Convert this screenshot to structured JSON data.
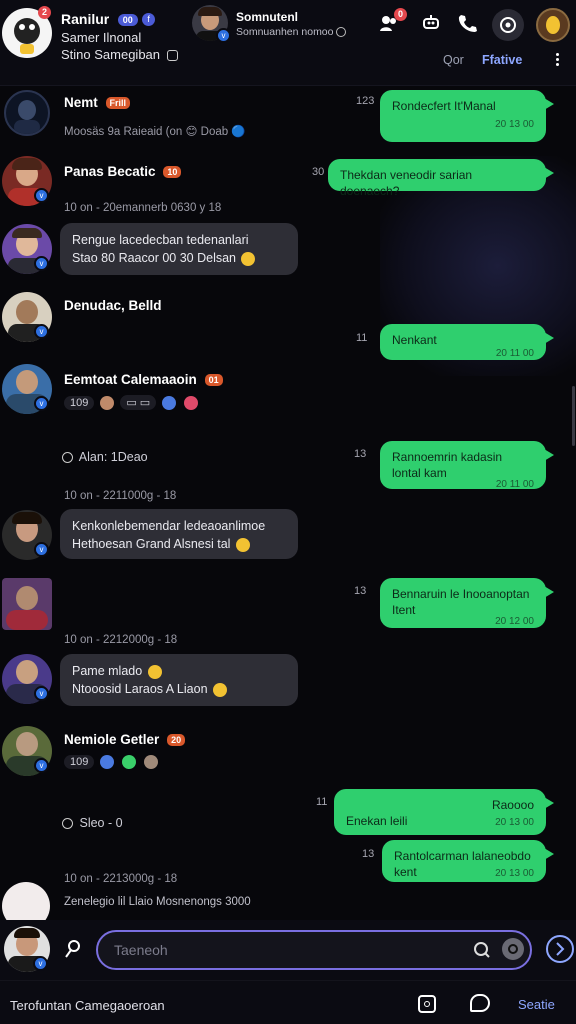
{
  "header": {
    "title": "Ranilur",
    "subtitle": "Samer Ilnonal",
    "status": "Stino Samegiban",
    "notif_badge": "2",
    "title_badge": "00",
    "contact_name": "Somnutenl",
    "contact_status": "Somnuanhen nomoo",
    "call_badge": "0",
    "tab_1": "Qor",
    "tab_2": "Ffative"
  },
  "messages": [
    {
      "user": "Nemt",
      "badge": "Frill",
      "meta": "Moosäs 9a Raieaid (on 😊 Doab 🔵",
      "out_text": "Rondecfert It'Manal",
      "out_time": "20 13 00",
      "side_time": "123"
    },
    {
      "user": "Panas Becatic",
      "badge": "10",
      "meta": "10 on - 20emannerb  0630 y 18",
      "out_text": "Thekdan veneodir sarian doenaech?",
      "side_time": "30"
    },
    {
      "user": "",
      "in_text_1": "Rengue lacedecban tedenanlari",
      "in_text_2": "Stao 80  Raacor 00  30  Delsan"
    },
    {
      "user": "Denudac, Belld",
      "out_text": "Nenkant",
      "out_time": "20 11 00",
      "side_time": "11"
    },
    {
      "user": "Eemtoat Calemaaoin",
      "badge": "01",
      "reacts": "109"
    },
    {
      "system": "Alan: 1Deao",
      "out_text": "Rannoemrin kadasin lontal kam",
      "out_time": "20 11 00",
      "side_time": "13"
    },
    {
      "meta": "10 on - 2211000g - 18",
      "in_text_1": "Kenkonlebemendar ledeaoanlimoe",
      "in_text_2": "Hethoesan  Grand  Alsnesi tal"
    },
    {
      "out_text": "Bennaruin le Inooanoptan Itent",
      "out_time": "20 12 00",
      "side_time": "13"
    },
    {
      "meta": "10 on - 2212000g - 18",
      "in_text_1": "Pame mlado",
      "in_text_2": "Ntooosid  Laraos  A  Liaon"
    },
    {
      "user": "Nemiole Getler",
      "badge": "20",
      "reacts": "109"
    },
    {
      "system": "Sleo - 0",
      "out_text_a": "Raoooo",
      "out_text_b": "Enekan leili",
      "out_time_a": "20 13 00",
      "side_time_a": "11"
    },
    {
      "out_text": "Rantolcarman lalaneobdo kent",
      "out_time": "20 13 00",
      "side_time": "13"
    },
    {
      "meta": "10 on - 2213000g - 18",
      "typing": "Zenelegio lil  Llaio  Mosnenongs 3000"
    }
  ],
  "composer": {
    "placeholder": "Taeneoh"
  },
  "bottom_bar": {
    "status_text": "Terofuntan Camegaoeroan",
    "action_label": "Seatie"
  },
  "colors": {
    "accent": "#7a6fe0",
    "outgoing_bubble": "#2fcf6e",
    "incoming_bubble": "#2e2e36",
    "badge": "#e5484d"
  }
}
